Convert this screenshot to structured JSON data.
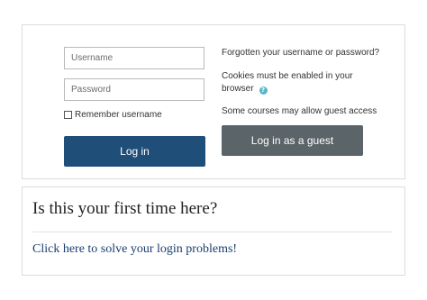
{
  "login": {
    "username_placeholder": "Username",
    "password_placeholder": "Password",
    "remember_label": "Remember username",
    "login_button": "Log in",
    "forgot_link": "Forgotten your username or password?",
    "cookies_note": "Cookies must be enabled in your browser",
    "guest_note": "Some courses may allow guest access",
    "guest_button": "Log in as a guest",
    "help_icon_glyph": "?"
  },
  "info": {
    "title": "Is this your first time here?",
    "link": "Click here to solve your login problems!"
  },
  "colors": {
    "login_button": "#1f4e79",
    "guest_button": "#5b6469",
    "help_icon": "#5bb5c9",
    "link": "#1a3d6e"
  }
}
